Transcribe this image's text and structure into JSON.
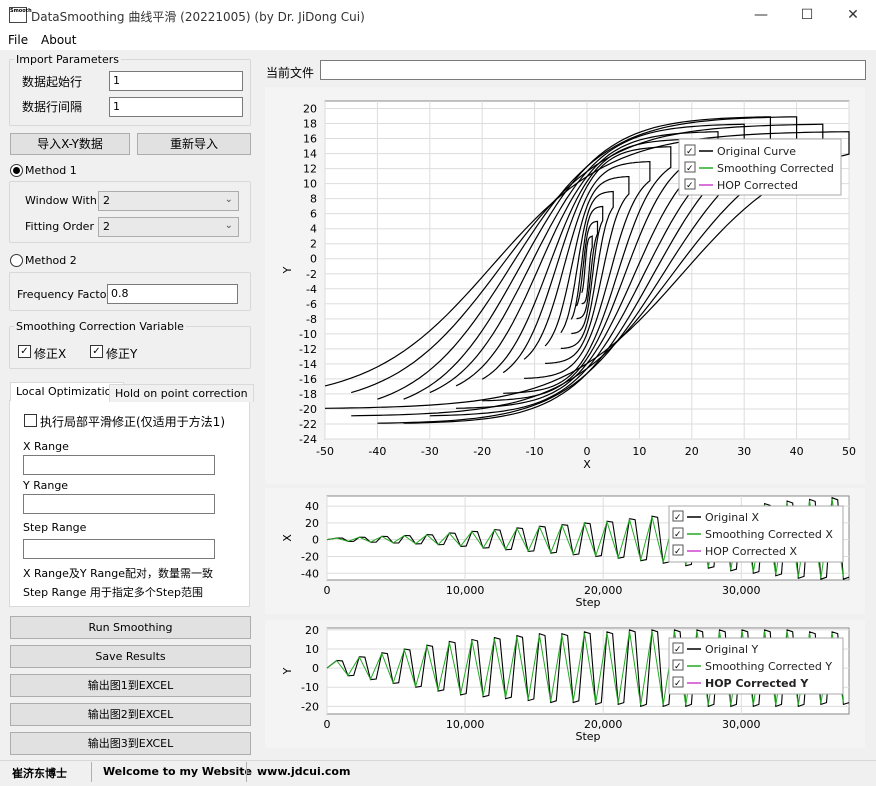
{
  "window": {
    "title": "DataSmoothing 曲线平滑 (20221005) (by Dr. JiDong Cui)",
    "icon_text": "Smooth",
    "minimize_icon": "minimize-icon",
    "maximize_icon": "maximize-icon",
    "close_icon": "close-icon"
  },
  "menu": {
    "file": "File",
    "about": "About"
  },
  "import": {
    "legend": "Import Parameters",
    "start_row_label": "数据起始行",
    "start_row_value": "1",
    "row_interval_label": "数据行间隔",
    "row_interval_value": "1",
    "import_button": "导入X-Y数据",
    "reimport_button": "重新导入"
  },
  "method1": {
    "label": "Method 1",
    "selected": true,
    "window_with_label": "Window With",
    "window_with_value": "2",
    "fitting_order_label": "Fitting Order",
    "fitting_order_value": "2"
  },
  "method2": {
    "label": "Method 2",
    "selected": false,
    "frequency_label": "Frequency Factor",
    "frequency_value": "0.8"
  },
  "correction": {
    "legend": "Smoothing Correction Variable",
    "fix_x_label": "修正X",
    "fix_x_checked": true,
    "fix_y_label": "修正Y",
    "fix_y_checked": true
  },
  "tabs": {
    "local": "Local Optimization",
    "hold": "Hold on point correction"
  },
  "local": {
    "local_smooth_label": "执行局部平滑修正(仅适用于方法1)",
    "local_smooth_checked": false,
    "x_range_label": "X Range",
    "x_range_value": "",
    "y_range_label": "Y Range",
    "y_range_value": "",
    "step_range_label": "Step Range",
    "step_range_value": "",
    "note1": "X Range及Y Range配对，数量需一致",
    "note2": "Step Range 用于指定多个Step范围"
  },
  "actions": {
    "run": "Run Smoothing",
    "save": "Save Results",
    "export1": "输出图1到EXCEL",
    "export2": "输出图2到EXCEL",
    "export3": "输出图3到EXCEL"
  },
  "current_file": {
    "label": "当前文件",
    "value": ""
  },
  "chart1": {
    "xlabel": "X",
    "ylabel": "Y",
    "xticks": [
      "-50",
      "-40",
      "-30",
      "-20",
      "-10",
      "0",
      "10",
      "20",
      "30",
      "40",
      "50"
    ],
    "yticks": [
      "20",
      "18",
      "16",
      "14",
      "12",
      "10",
      "8",
      "6",
      "4",
      "2",
      "0",
      "-2",
      "-4",
      "-6",
      "-8",
      "-10",
      "-12",
      "-14",
      "-16",
      "-18",
      "-20",
      "-22",
      "-24"
    ],
    "legend": [
      "Original Curve",
      "Smoothing Corrected",
      "HOP Corrected"
    ]
  },
  "chart2": {
    "xlabel": "Step",
    "ylabel": "X",
    "xticks": [
      "0",
      "10,000",
      "20,000",
      "30,000"
    ],
    "yticks": [
      "40",
      "20",
      "0",
      "-20",
      "-40"
    ],
    "legend": [
      "Original X",
      "Smoothing Corrected X",
      "HOP Corrected X"
    ]
  },
  "chart3": {
    "xlabel": "Step",
    "ylabel": "Y",
    "xticks": [
      "0",
      "10,000",
      "20,000",
      "30,000"
    ],
    "yticks": [
      "20",
      "10",
      "0",
      "-10",
      "-20"
    ],
    "legend": [
      "Original Y",
      "Smoothing Corrected Y",
      "HOP Corrected Y"
    ]
  },
  "chart_data": [
    {
      "type": "line",
      "xlabel": "X",
      "ylabel": "Y",
      "xlim": [
        -50,
        50
      ],
      "ylim": [
        -24,
        21
      ],
      "grid": true,
      "legend_position": "top-right",
      "series": [
        {
          "name": "Original Curve",
          "color": "#000000",
          "description_points": []
        },
        {
          "name": "Smoothing Corrected",
          "color": "#22aa22"
        },
        {
          "name": "HOP Corrected",
          "color": "#cc44cc"
        }
      ],
      "hysteresis_amplitudes": [
        {
          "x": 1,
          "y": 4
        },
        {
          "x": 2,
          "y": 6
        },
        {
          "x": 3,
          "y": 8
        },
        {
          "x": 5,
          "y": 10
        },
        {
          "x": 8,
          "y": 12
        },
        {
          "x": 12,
          "y": 14
        },
        {
          "x": 16,
          "y": 16
        },
        {
          "x": 20,
          "y": 17
        },
        {
          "x": 25,
          "y": 18
        },
        {
          "x": 30,
          "y": 19
        },
        {
          "x": 35,
          "y": 20
        },
        {
          "x": 40,
          "y": 20
        },
        {
          "x": 45,
          "y": 19
        },
        {
          "x": 50,
          "y": 18
        }
      ]
    },
    {
      "type": "line",
      "xlabel": "Step",
      "ylabel": "X",
      "xlim": [
        0,
        37800
      ],
      "ylim": [
        -48,
        52
      ],
      "grid": true,
      "legend_position": "top-right",
      "series": [
        {
          "name": "Original X",
          "color": "#000000"
        },
        {
          "name": "Smoothing Corrected X",
          "color": "#22aa22"
        },
        {
          "name": "HOP Corrected X",
          "color": "#cc44cc"
        }
      ],
      "cycle_amplitudes": [
        2,
        3,
        4,
        5,
        6,
        8,
        10,
        12,
        14,
        16,
        18,
        20,
        22,
        25,
        28,
        31,
        34,
        37,
        40,
        43,
        46,
        48,
        50
      ]
    },
    {
      "type": "line",
      "xlabel": "Step",
      "ylabel": "Y",
      "xlim": [
        0,
        37800
      ],
      "ylim": [
        -24,
        21
      ],
      "grid": true,
      "legend_position": "top-right",
      "series": [
        {
          "name": "Original Y",
          "color": "#000000"
        },
        {
          "name": "Smoothing Corrected Y",
          "color": "#22aa22"
        },
        {
          "name": "HOP Corrected Y",
          "color": "#cc44cc"
        }
      ],
      "cycle_amplitudes": [
        4,
        6,
        8,
        10,
        12,
        14,
        15,
        16,
        17,
        18,
        18,
        19,
        19,
        20,
        20,
        20,
        20,
        20,
        20,
        20,
        20,
        19,
        19
      ]
    }
  ]
}
